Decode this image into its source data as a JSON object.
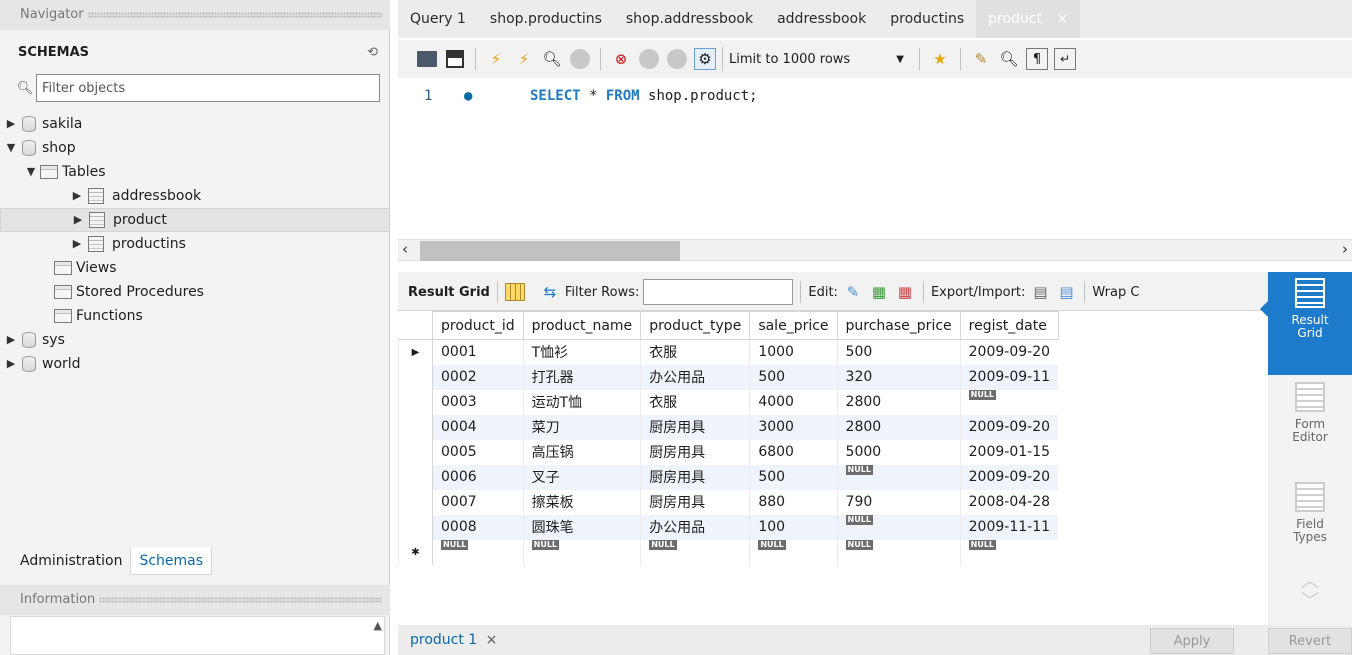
{
  "navigator": {
    "header": "Navigator",
    "schemas_title": "SCHEMAS",
    "filter_placeholder": "Filter objects",
    "tree": [
      {
        "label": "sakila",
        "type": "schema",
        "expanded": false
      },
      {
        "label": "shop",
        "type": "schema",
        "expanded": true
      },
      {
        "label": "Tables",
        "type": "folder",
        "expanded": true
      },
      {
        "label": "addressbook",
        "type": "table"
      },
      {
        "label": "product",
        "type": "table",
        "selected": true
      },
      {
        "label": "productins",
        "type": "table"
      },
      {
        "label": "Views",
        "type": "folder"
      },
      {
        "label": "Stored Procedures",
        "type": "folder"
      },
      {
        "label": "Functions",
        "type": "folder"
      },
      {
        "label": "sys",
        "type": "schema",
        "expanded": false
      },
      {
        "label": "world",
        "type": "schema",
        "expanded": false
      }
    ],
    "bottom_tabs": [
      "Administration",
      "Schemas"
    ],
    "info_header": "Information"
  },
  "query_tabs": [
    {
      "label": "Query 1"
    },
    {
      "label": "shop.productins"
    },
    {
      "label": "shop.addressbook"
    },
    {
      "label": "addressbook"
    },
    {
      "label": "productins"
    },
    {
      "label": "product",
      "active": true,
      "close": "×"
    }
  ],
  "toolbar": {
    "limit_label": "Limit to 1000 rows"
  },
  "editor": {
    "line_number": "1",
    "dot": "●",
    "sql_kw1": "SELECT",
    "sql_mid": " * ",
    "sql_kw2": "FROM",
    "sql_rest": " shop.product;"
  },
  "result_toolbar": {
    "result_grid": "Result Grid",
    "filter_rows": "Filter Rows:",
    "edit": "Edit:",
    "export_import": "Export/Import:",
    "wrap": "Wrap C"
  },
  "grid": {
    "columns": [
      "product_id",
      "product_name",
      "product_type",
      "sale_price",
      "purchase_price",
      "regist_date"
    ],
    "rows": [
      [
        "0001",
        "T恤衫",
        "衣服",
        "1000",
        "500",
        "2009-09-20"
      ],
      [
        "0002",
        "打孔器",
        "办公用品",
        "500",
        "320",
        "2009-09-11"
      ],
      [
        "0003",
        "运动T恤",
        "衣服",
        "4000",
        "2800",
        "NULL"
      ],
      [
        "0004",
        "菜刀",
        "厨房用具",
        "3000",
        "2800",
        "2009-09-20"
      ],
      [
        "0005",
        "高压锅",
        "厨房用具",
        "6800",
        "5000",
        "2009-01-15"
      ],
      [
        "0006",
        "叉子",
        "厨房用具",
        "500",
        "NULL",
        "2009-09-20"
      ],
      [
        "0007",
        "擦菜板",
        "厨房用具",
        "880",
        "790",
        "2008-04-28"
      ],
      [
        "0008",
        "圆珠笔",
        "办公用品",
        "100",
        "NULL",
        "2009-11-11"
      ]
    ],
    "null_label": "NULL"
  },
  "side_panel": {
    "result_grid": [
      "Result",
      "Grid"
    ],
    "form_editor": [
      "Form",
      "Editor"
    ],
    "field_types": [
      "Field",
      "Types"
    ]
  },
  "bottom": {
    "result_tab": "product 1",
    "close": "×",
    "apply": "Apply",
    "revert": "Revert"
  }
}
